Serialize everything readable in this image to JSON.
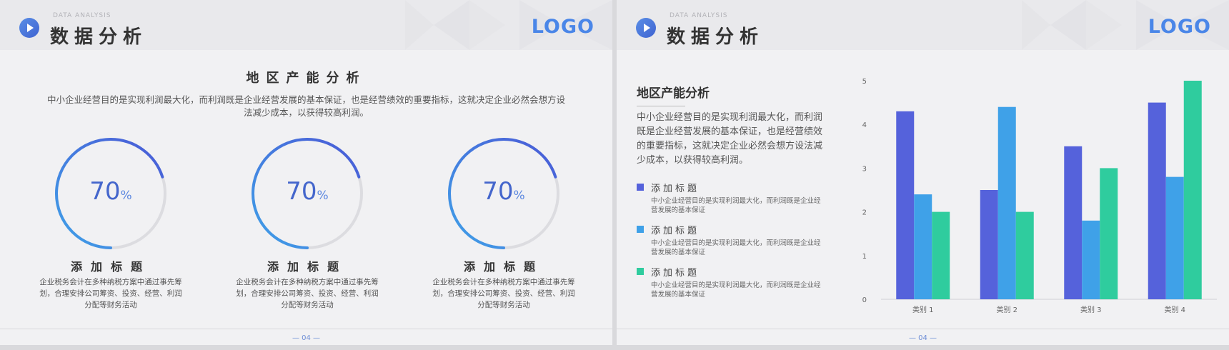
{
  "header": {
    "subtitle": "DATA ANALYSIS",
    "title": "数据分析",
    "logo": "LOGO"
  },
  "footer": {
    "page": "—    04    —"
  },
  "left": {
    "title": "地区产能分析",
    "desc": "中小企业经营目的是实现利润最大化，而利润既是企业经营发展的基本保证，也是经营绩效的重要指标，这就决定企业必然会想方设法减少成本，以获得较高利润。",
    "items": [
      {
        "value": "70",
        "unit": "%",
        "progress": 0.7,
        "title": "添加标题",
        "desc": "企业税务会计在多种纳税方案中通过事先筹划，合理安排公司筹资、投资、经营、利润分配等财务活动"
      },
      {
        "value": "70",
        "unit": "%",
        "progress": 0.7,
        "title": "添加标题",
        "desc": "企业税务会计在多种纳税方案中通过事先筹划，合理安排公司筹资、投资、经营、利润分配等财务活动"
      },
      {
        "value": "70",
        "unit": "%",
        "progress": 0.7,
        "title": "添加标题",
        "desc": "企业税务会计在多种纳税方案中通过事先筹划，合理安排公司筹资、投资、经营、利润分配等财务活动"
      }
    ]
  },
  "right": {
    "title": "地区产能分析",
    "desc": "中小企业经营目的是实现利润最大化，而利润既是企业经营发展的基本保证，也是经营绩效的重要指标，这就决定企业必然会想方设法减少成本，以获得较高利润。",
    "legend": [
      {
        "title": "添加标题",
        "desc": "中小企业经营目的是实现利润最大化，而利润既是企业经营发展的基本保证",
        "color": "#5562db"
      },
      {
        "title": "添加标题",
        "desc": "中小企业经营目的是实现利润最大化，而利润既是企业经营发展的基本保证",
        "color": "#3fa1e8"
      },
      {
        "title": "添加标题",
        "desc": "中小企业经营目的是实现利润最大化，而利润既是企业经营发展的基本保证",
        "color": "#2fcc9e"
      }
    ]
  },
  "chart_data": {
    "type": "bar",
    "categories": [
      "类别 1",
      "类别 2",
      "类别 3",
      "类别 4"
    ],
    "series": [
      {
        "values": [
          4.3,
          2.5,
          3.5,
          4.5
        ],
        "color": "#5562db"
      },
      {
        "values": [
          2.4,
          4.4,
          1.8,
          2.8
        ],
        "color": "#3fa1e8"
      },
      {
        "values": [
          2.0,
          2.0,
          3.0,
          5.0
        ],
        "color": "#2fcc9e"
      }
    ],
    "yticks": [
      "0",
      "1",
      "2",
      "3",
      "4",
      "5"
    ],
    "ylim": [
      0,
      5
    ],
    "grid": false,
    "legend": "none"
  }
}
